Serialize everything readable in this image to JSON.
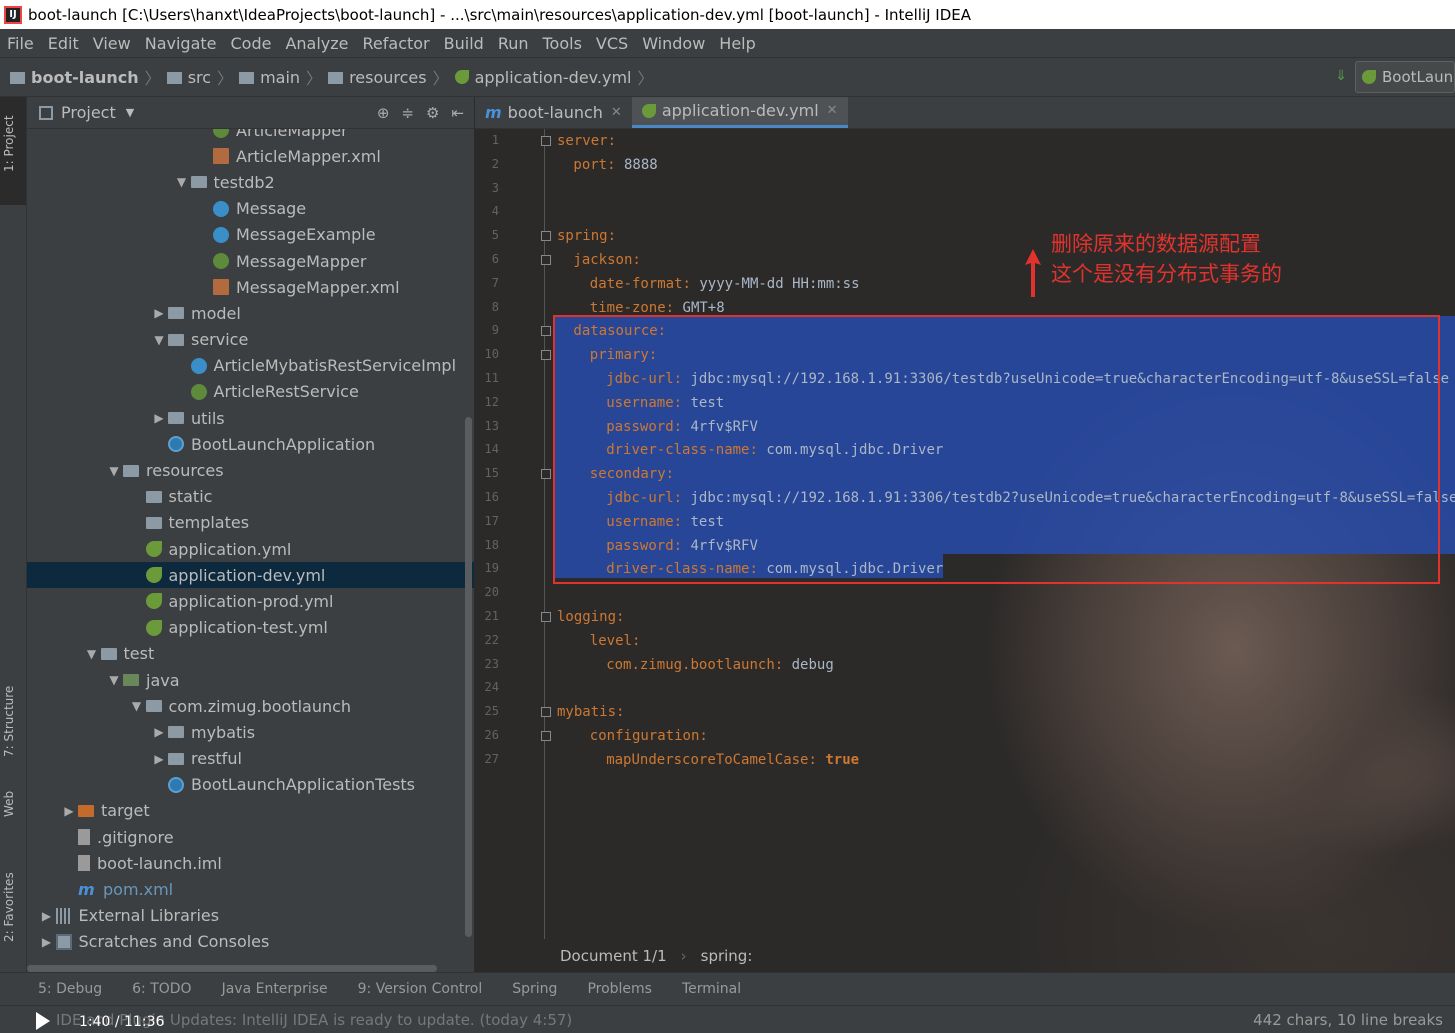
{
  "window": {
    "title": "boot-launch [C:\\Users\\hanxt\\IdeaProjects\\boot-launch] - ...\\src\\main\\resources\\application-dev.yml [boot-launch] - IntelliJ IDEA",
    "app_icon": "IJ"
  },
  "menu": [
    "File",
    "Edit",
    "View",
    "Navigate",
    "Code",
    "Analyze",
    "Refactor",
    "Build",
    "Run",
    "Tools",
    "VCS",
    "Window",
    "Help"
  ],
  "breadcrumbs": [
    "boot-launch",
    "src",
    "main",
    "resources",
    "application-dev.yml"
  ],
  "run_config": "BootLaun",
  "side_tabs": {
    "project": "1: Project",
    "structure": "7: Structure",
    "web": "Web",
    "favorites": "2: Favorites"
  },
  "project_panel": {
    "title": "Project",
    "tree": [
      {
        "label": "ArticleMapper",
        "icon": "interface-icon",
        "indent": 8,
        "arrow": ""
      },
      {
        "label": "ArticleMapper.xml",
        "icon": "xml-icon",
        "indent": 8,
        "arrow": ""
      },
      {
        "label": "testdb2",
        "icon": "folder-icon",
        "indent": 7,
        "arrow": "▼"
      },
      {
        "label": "Message",
        "icon": "class-icon",
        "indent": 8,
        "arrow": ""
      },
      {
        "label": "MessageExample",
        "icon": "class-icon",
        "indent": 8,
        "arrow": ""
      },
      {
        "label": "MessageMapper",
        "icon": "interface-icon",
        "indent": 8,
        "arrow": ""
      },
      {
        "label": "MessageMapper.xml",
        "icon": "xml-icon",
        "indent": 8,
        "arrow": ""
      },
      {
        "label": "model",
        "icon": "folder-icon",
        "indent": 6,
        "arrow": "▶"
      },
      {
        "label": "service",
        "icon": "folder-icon",
        "indent": 6,
        "arrow": "▼"
      },
      {
        "label": "ArticleMybatisRestServiceImpl",
        "icon": "class-icon",
        "indent": 7,
        "arrow": ""
      },
      {
        "label": "ArticleRestService",
        "icon": "interface-icon",
        "indent": 7,
        "arrow": ""
      },
      {
        "label": "utils",
        "icon": "folder-icon",
        "indent": 6,
        "arrow": "▶"
      },
      {
        "label": "BootLaunchApplication",
        "icon": "spring-class-icon",
        "indent": 6,
        "arrow": ""
      },
      {
        "label": "resources",
        "icon": "folder-icon",
        "indent": 4,
        "arrow": "▼"
      },
      {
        "label": "static",
        "icon": "folder-icon",
        "indent": 5,
        "arrow": ""
      },
      {
        "label": "templates",
        "icon": "folder-icon",
        "indent": 5,
        "arrow": ""
      },
      {
        "label": "application.yml",
        "icon": "yml-icon",
        "indent": 5,
        "arrow": ""
      },
      {
        "label": "application-dev.yml",
        "icon": "yml-icon",
        "indent": 5,
        "arrow": "",
        "selected": true
      },
      {
        "label": "application-prod.yml",
        "icon": "yml-icon",
        "indent": 5,
        "arrow": ""
      },
      {
        "label": "application-test.yml",
        "icon": "yml-icon",
        "indent": 5,
        "arrow": ""
      },
      {
        "label": "test",
        "icon": "folder-icon",
        "indent": 3,
        "arrow": "▼"
      },
      {
        "label": "java",
        "icon": "source-folder-icon",
        "indent": 4,
        "arrow": "▼"
      },
      {
        "label": "com.zimug.bootlaunch",
        "icon": "folder-icon",
        "indent": 5,
        "arrow": "▼"
      },
      {
        "label": "mybatis",
        "icon": "folder-icon",
        "indent": 6,
        "arrow": "▶"
      },
      {
        "label": "restful",
        "icon": "folder-icon",
        "indent": 6,
        "arrow": "▶"
      },
      {
        "label": "BootLaunchApplicationTests",
        "icon": "spring-class-icon",
        "indent": 6,
        "arrow": ""
      },
      {
        "label": "target",
        "icon": "excluded-folder-icon",
        "indent": 2,
        "arrow": "▶"
      },
      {
        "label": ".gitignore",
        "icon": "file-icon",
        "indent": 2,
        "arrow": ""
      },
      {
        "label": "boot-launch.iml",
        "icon": "file-icon",
        "indent": 2,
        "arrow": ""
      },
      {
        "label": "pom.xml",
        "icon": "maven-icon",
        "indent": 2,
        "arrow": "",
        "blue": true
      },
      {
        "label": "External Libraries",
        "icon": "library-icon",
        "indent": 1,
        "arrow": "▶"
      },
      {
        "label": "Scratches and Consoles",
        "icon": "console-icon",
        "indent": 1,
        "arrow": "▶"
      }
    ]
  },
  "editor_tabs": [
    {
      "label": "boot-launch",
      "icon": "maven-icon",
      "active": false
    },
    {
      "label": "application-dev.yml",
      "icon": "yml-icon",
      "active": true
    }
  ],
  "code_lines": [
    {
      "n": "1",
      "indent": 0,
      "key": "server:",
      "val": ""
    },
    {
      "n": "2",
      "indent": 2,
      "key": "port:",
      "val": " 8888"
    },
    {
      "n": "3",
      "indent": 0,
      "key": "",
      "val": ""
    },
    {
      "n": "4",
      "indent": 0,
      "key": "",
      "val": ""
    },
    {
      "n": "5",
      "indent": 0,
      "key": "spring:",
      "val": ""
    },
    {
      "n": "6",
      "indent": 2,
      "key": "jackson:",
      "val": ""
    },
    {
      "n": "7",
      "indent": 4,
      "key": "date-format:",
      "val": " yyyy-MM-dd HH:mm:ss"
    },
    {
      "n": "8",
      "indent": 4,
      "key": "time-zone:",
      "val": " GMT+8"
    },
    {
      "n": "9",
      "indent": 2,
      "key": "datasource:",
      "val": ""
    },
    {
      "n": "10",
      "indent": 4,
      "key": "primary:",
      "val": ""
    },
    {
      "n": "11",
      "indent": 6,
      "key": "jdbc-url:",
      "val": " jdbc:mysql://192.168.1.91:3306/testdb?useUnicode=true&characterEncoding=utf-8&useSSL=false"
    },
    {
      "n": "12",
      "indent": 6,
      "key": "username:",
      "val": " test"
    },
    {
      "n": "13",
      "indent": 6,
      "key": "password:",
      "val": " 4rfv$RFV"
    },
    {
      "n": "14",
      "indent": 6,
      "key": "driver-class-name:",
      "val": " com.mysql.jdbc.Driver"
    },
    {
      "n": "15",
      "indent": 4,
      "key": "secondary:",
      "val": ""
    },
    {
      "n": "16",
      "indent": 6,
      "key": "jdbc-url:",
      "val": " jdbc:mysql://192.168.1.91:3306/testdb2?useUnicode=true&characterEncoding=utf-8&useSSL=false"
    },
    {
      "n": "17",
      "indent": 6,
      "key": "username:",
      "val": " test"
    },
    {
      "n": "18",
      "indent": 6,
      "key": "password:",
      "val": " 4rfv$RFV"
    },
    {
      "n": "19",
      "indent": 6,
      "key": "driver-class-name:",
      "val": " com.mysql.jdbc.Driver"
    },
    {
      "n": "20",
      "indent": 0,
      "key": "",
      "val": ""
    },
    {
      "n": "21",
      "indent": 0,
      "key": "logging:",
      "val": ""
    },
    {
      "n": "22",
      "indent": 4,
      "key": "level:",
      "val": ""
    },
    {
      "n": "23",
      "indent": 6,
      "key": "com.zimug.bootlaunch:",
      "val": " debug"
    },
    {
      "n": "24",
      "indent": 0,
      "key": "",
      "val": ""
    },
    {
      "n": "25",
      "indent": 0,
      "key": "mybatis:",
      "val": ""
    },
    {
      "n": "26",
      "indent": 4,
      "key": "configuration:",
      "val": ""
    },
    {
      "n": "27",
      "indent": 6,
      "key": "mapUnderscoreToCamelCase:",
      "val": " true"
    }
  ],
  "annotation": {
    "line1": "删除原来的数据源配置",
    "line2": "这个是没有分布式事务的"
  },
  "editor_breadcrumb": {
    "doc": "Document 1/1",
    "path": "spring:"
  },
  "tool_windows": [
    "5: Debug",
    "6: TODO",
    "Java Enterprise",
    "9: Version Control",
    "Spring",
    "Problems",
    "Terminal"
  ],
  "status": {
    "message": "IDE and Plugin Updates: IntelliJ IDEA is ready to update. (today 4:57)",
    "right": "442 chars, 10 line breaks"
  },
  "player": {
    "time": "1:40 / 11:36"
  },
  "colors": {
    "key": "#cc7832",
    "value": "#a9b7c6",
    "selection": "#2d4bab",
    "annotation": "#e0332e"
  }
}
